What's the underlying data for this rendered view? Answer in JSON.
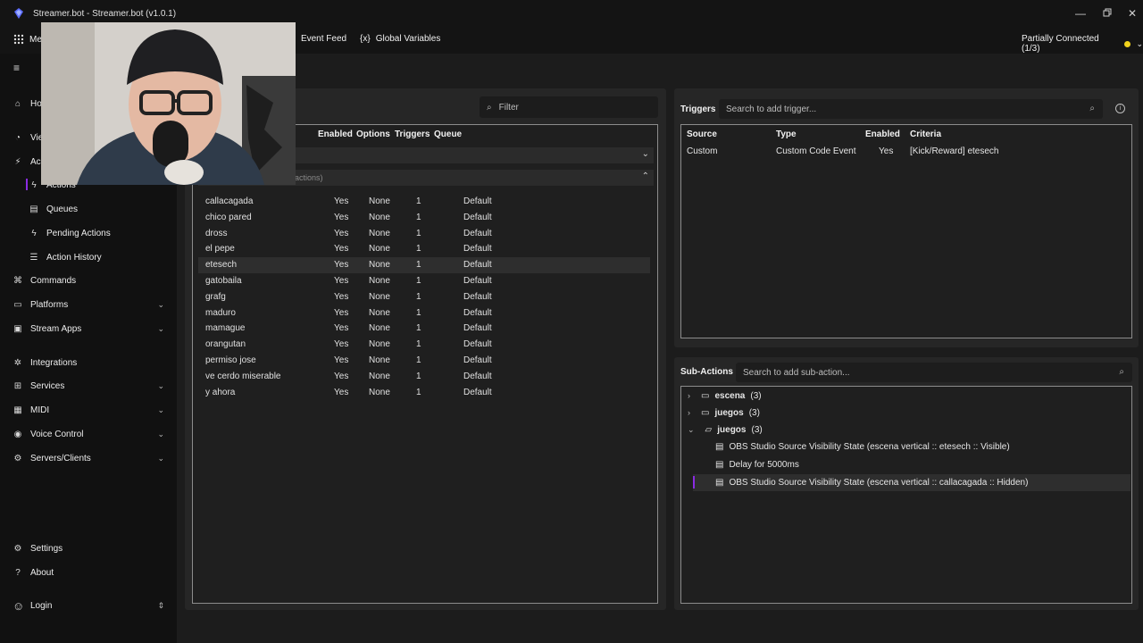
{
  "window": {
    "title": "Streamer.bot - Streamer.bot (v1.0.1)"
  },
  "topbar": {
    "menu_label": "Me",
    "event_feed": "Event Feed",
    "global_variables": "Global Variables",
    "connection_status": "Partially Connected (1/3)"
  },
  "sidebar": {
    "home": "Ho",
    "views": "Vie",
    "actions_group": "Ac",
    "actions": "Actions",
    "queues": "Queues",
    "pending_actions": "Pending Actions",
    "action_history": "Action History",
    "commands": "Commands",
    "platforms": "Platforms",
    "stream_apps": "Stream Apps",
    "integrations": "Integrations",
    "services": "Services",
    "midi": "MIDI",
    "voice_control": "Voice Control",
    "servers_clients": "Servers/Clients",
    "settings": "Settings",
    "about": "About",
    "login": "Login"
  },
  "actions_panel": {
    "filter_placeholder": "Filter",
    "columns": {
      "enabled": "Enabled",
      "options": "Options",
      "triggers": "Triggers",
      "queue": "Queue"
    },
    "group_label": "actions)",
    "rows": [
      {
        "name": "callacagada",
        "enabled": "Yes",
        "options": "None",
        "triggers": "1",
        "queue": "Default"
      },
      {
        "name": "chico pared",
        "enabled": "Yes",
        "options": "None",
        "triggers": "1",
        "queue": "Default"
      },
      {
        "name": "dross",
        "enabled": "Yes",
        "options": "None",
        "triggers": "1",
        "queue": "Default"
      },
      {
        "name": "el pepe",
        "enabled": "Yes",
        "options": "None",
        "triggers": "1",
        "queue": "Default"
      },
      {
        "name": "etesech",
        "enabled": "Yes",
        "options": "None",
        "triggers": "1",
        "queue": "Default"
      },
      {
        "name": "gatobaila",
        "enabled": "Yes",
        "options": "None",
        "triggers": "1",
        "queue": "Default"
      },
      {
        "name": "grafg",
        "enabled": "Yes",
        "options": "None",
        "triggers": "1",
        "queue": "Default"
      },
      {
        "name": "maduro",
        "enabled": "Yes",
        "options": "None",
        "triggers": "1",
        "queue": "Default"
      },
      {
        "name": "mamague",
        "enabled": "Yes",
        "options": "None",
        "triggers": "1",
        "queue": "Default"
      },
      {
        "name": "orangutan",
        "enabled": "Yes",
        "options": "None",
        "triggers": "1",
        "queue": "Default"
      },
      {
        "name": "permiso jose",
        "enabled": "Yes",
        "options": "None",
        "triggers": "1",
        "queue": "Default"
      },
      {
        "name": "ve cerdo miserable",
        "enabled": "Yes",
        "options": "None",
        "triggers": "1",
        "queue": "Default"
      },
      {
        "name": "y ahora",
        "enabled": "Yes",
        "options": "None",
        "triggers": "1",
        "queue": "Default"
      }
    ]
  },
  "triggers_panel": {
    "title": "Triggers",
    "search_placeholder": "Search to add trigger...",
    "columns": {
      "source": "Source",
      "type": "Type",
      "enabled": "Enabled",
      "criteria": "Criteria"
    },
    "rows": [
      {
        "source": "Custom",
        "type": "Custom Code Event",
        "enabled": "Yes",
        "criteria": "[Kick/Reward] etesech"
      }
    ]
  },
  "subactions_panel": {
    "title": "Sub-Actions",
    "search_placeholder": "Search to add sub-action...",
    "groups": [
      {
        "name": "escena",
        "count": "(3)"
      },
      {
        "name": "juegos",
        "count": "(3)"
      },
      {
        "name": "juegos",
        "count": "(3)"
      }
    ],
    "items": [
      "OBS Studio Source Visibility State (escena vertical :: etesech :: Visible)",
      "Delay for 5000ms",
      "OBS Studio Source Visibility State (escena vertical :: callacagada :: Hidden)"
    ]
  },
  "colors": {
    "accent": "#8a2be2",
    "status": "#f1d21c",
    "background": "#1c1c1c"
  }
}
